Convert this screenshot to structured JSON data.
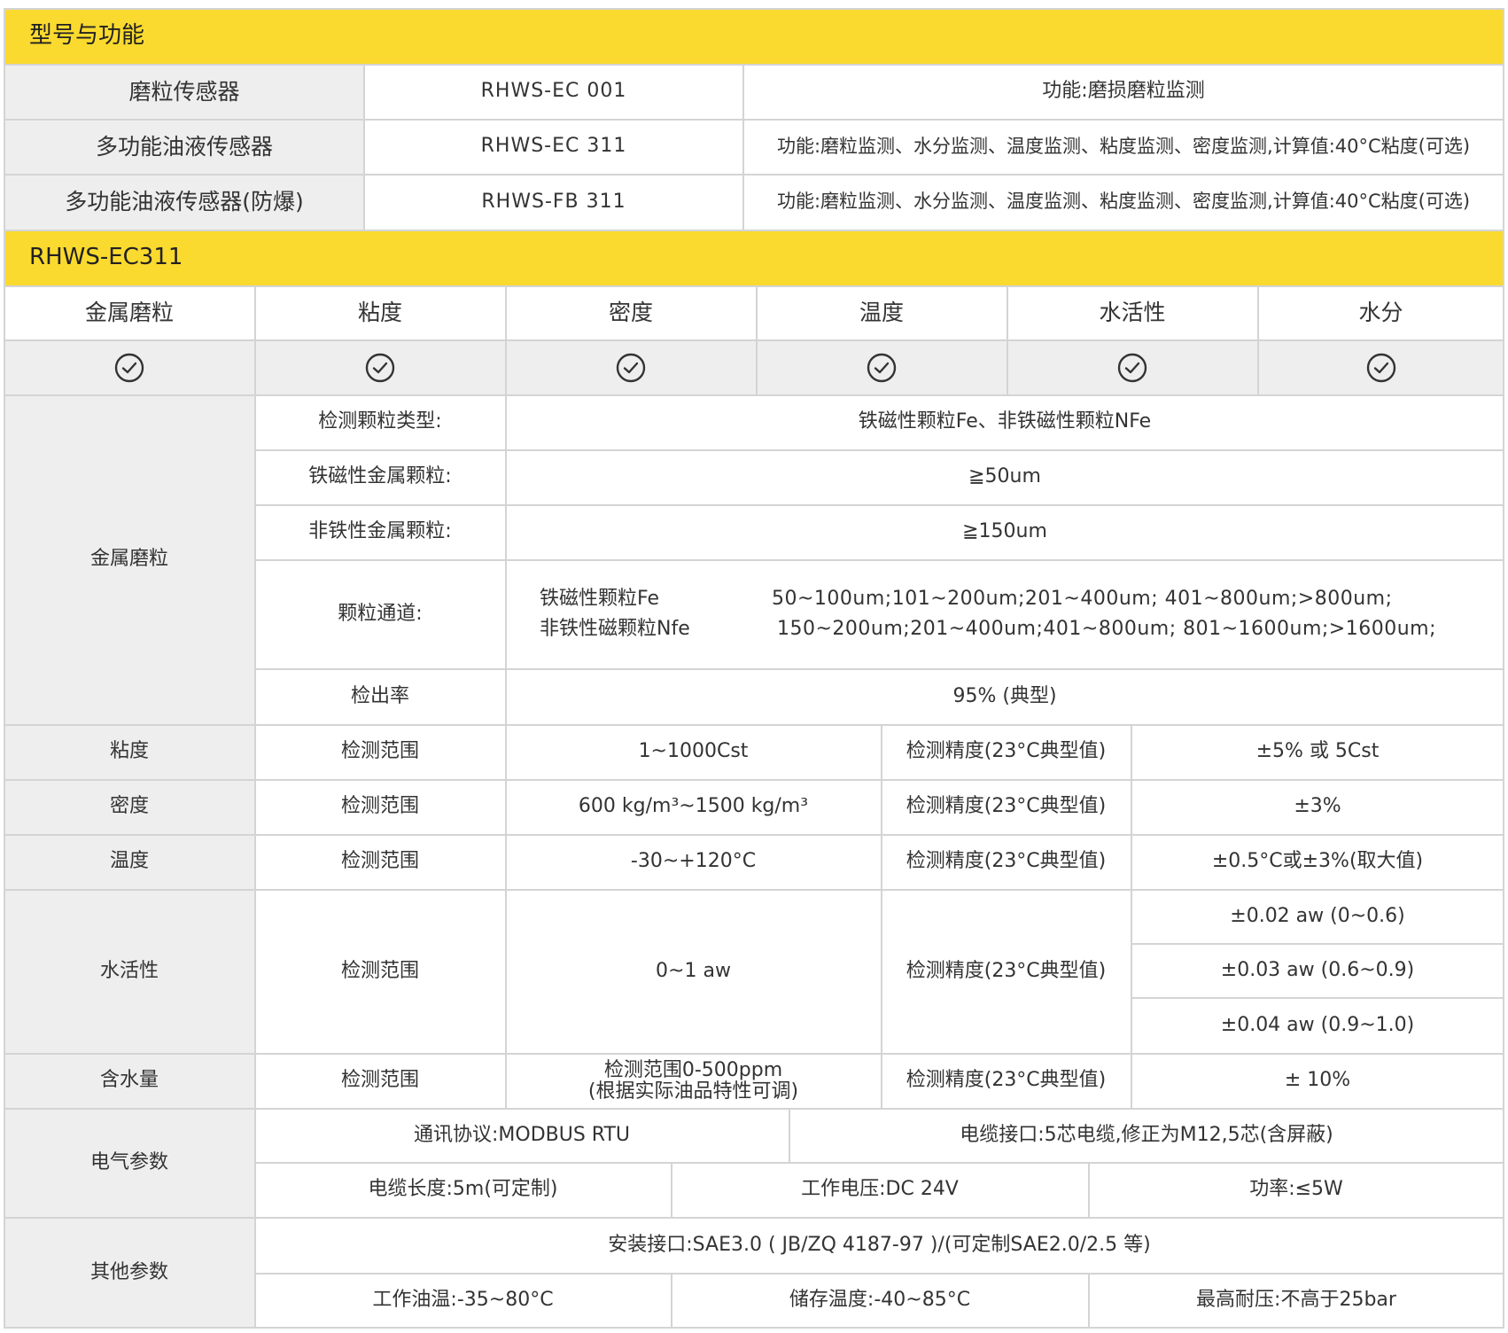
{
  "section1": {
    "title": "型号与功能",
    "rows": [
      {
        "name": "磨粒传感器",
        "model": "RHWS-EC 001",
        "function": "功能:磨损磨粒监测"
      },
      {
        "name": "多功能油液传感器",
        "model": "RHWS-EC 311",
        "function": "功能:磨粒监测、水分监测、温度监测、粘度监测、密度监测,计算值:40°C粘度(可选)"
      },
      {
        "name": "多功能油液传感器(防爆)",
        "model": "RHWS-FB 311",
        "function": "功能:磨粒监测、水分监测、温度监测、粘度监测、密度监测,计算值:40°C粘度(可选)"
      }
    ]
  },
  "section2": {
    "title": "RHWS-EC311",
    "features": [
      "金属磨粒",
      "粘度",
      "密度",
      "温度",
      "水活性",
      "水分"
    ],
    "check_icon": "check-circle-icon"
  },
  "metal": {
    "label": "金属磨粒",
    "type_label": "检测颗粒类型:",
    "type_value": "铁磁性颗粒Fe、非铁磁性颗粒NFe",
    "fe_label": "铁磁性金属颗粒:",
    "fe_value": "≧50um",
    "nfe_label": "非铁性金属颗粒:",
    "nfe_value": "≧150um",
    "channel_label": "颗粒通道:",
    "channel_fe_name": "铁磁性颗粒Fe",
    "channel_nfe_name": "非铁性磁颗粒Nfe",
    "channel_fe_ranges": "50~100um;101~200um;201~400um; 401~800um;>800um;",
    "channel_nfe_ranges": "150~200um;201~400um;401~800um; 801~1600um;>1600um;",
    "rate_label": "检出率",
    "rate_value": "95% (典型)"
  },
  "specs": {
    "range_label": "检测范围",
    "accuracy_label": "检测精度(23°C典型值)",
    "viscosity": {
      "label": "粘度",
      "range": "1~1000Cst",
      "accuracy": "±5% 或 5Cst"
    },
    "density": {
      "label": "密度",
      "range": "600 kg/m³~1500 kg/m³",
      "accuracy": "±3%"
    },
    "temperature": {
      "label": "温度",
      "range": "-30~+120°C",
      "accuracy": "±0.5°C或±3%(取大值)"
    },
    "water_activity": {
      "label": "水活性",
      "range": "0~1 aw",
      "accuracy": [
        "±0.02 aw (0~0.6)",
        "±0.03 aw (0.6~0.9)",
        "±0.04 aw (0.9~1.0)"
      ]
    },
    "water_content": {
      "label": "含水量",
      "range_line1": "检测范围0-500ppm",
      "range_line2": "(根据实际油品特性可调)",
      "accuracy": "± 10%"
    }
  },
  "electrical": {
    "label": "电气参数",
    "protocol": "通讯协议:MODBUS RTU",
    "cable_interface": "电缆接口:5芯电缆,修正为M12,5芯(含屏蔽)",
    "cable_length": "电缆长度:5m(可定制)",
    "voltage": "工作电压:DC 24V",
    "power": "功率:≤5W"
  },
  "other": {
    "label": "其他参数",
    "interface": "安装接口:SAE3.0 ( JB/ZQ 4187-97 )/(可定制SAE2.0/2.5 等)",
    "oil_temp": "工作油温:-35~80°C",
    "storage_temp": "储存温度:-40~85°C",
    "max_pressure": "最高耐压:不高于25bar"
  }
}
